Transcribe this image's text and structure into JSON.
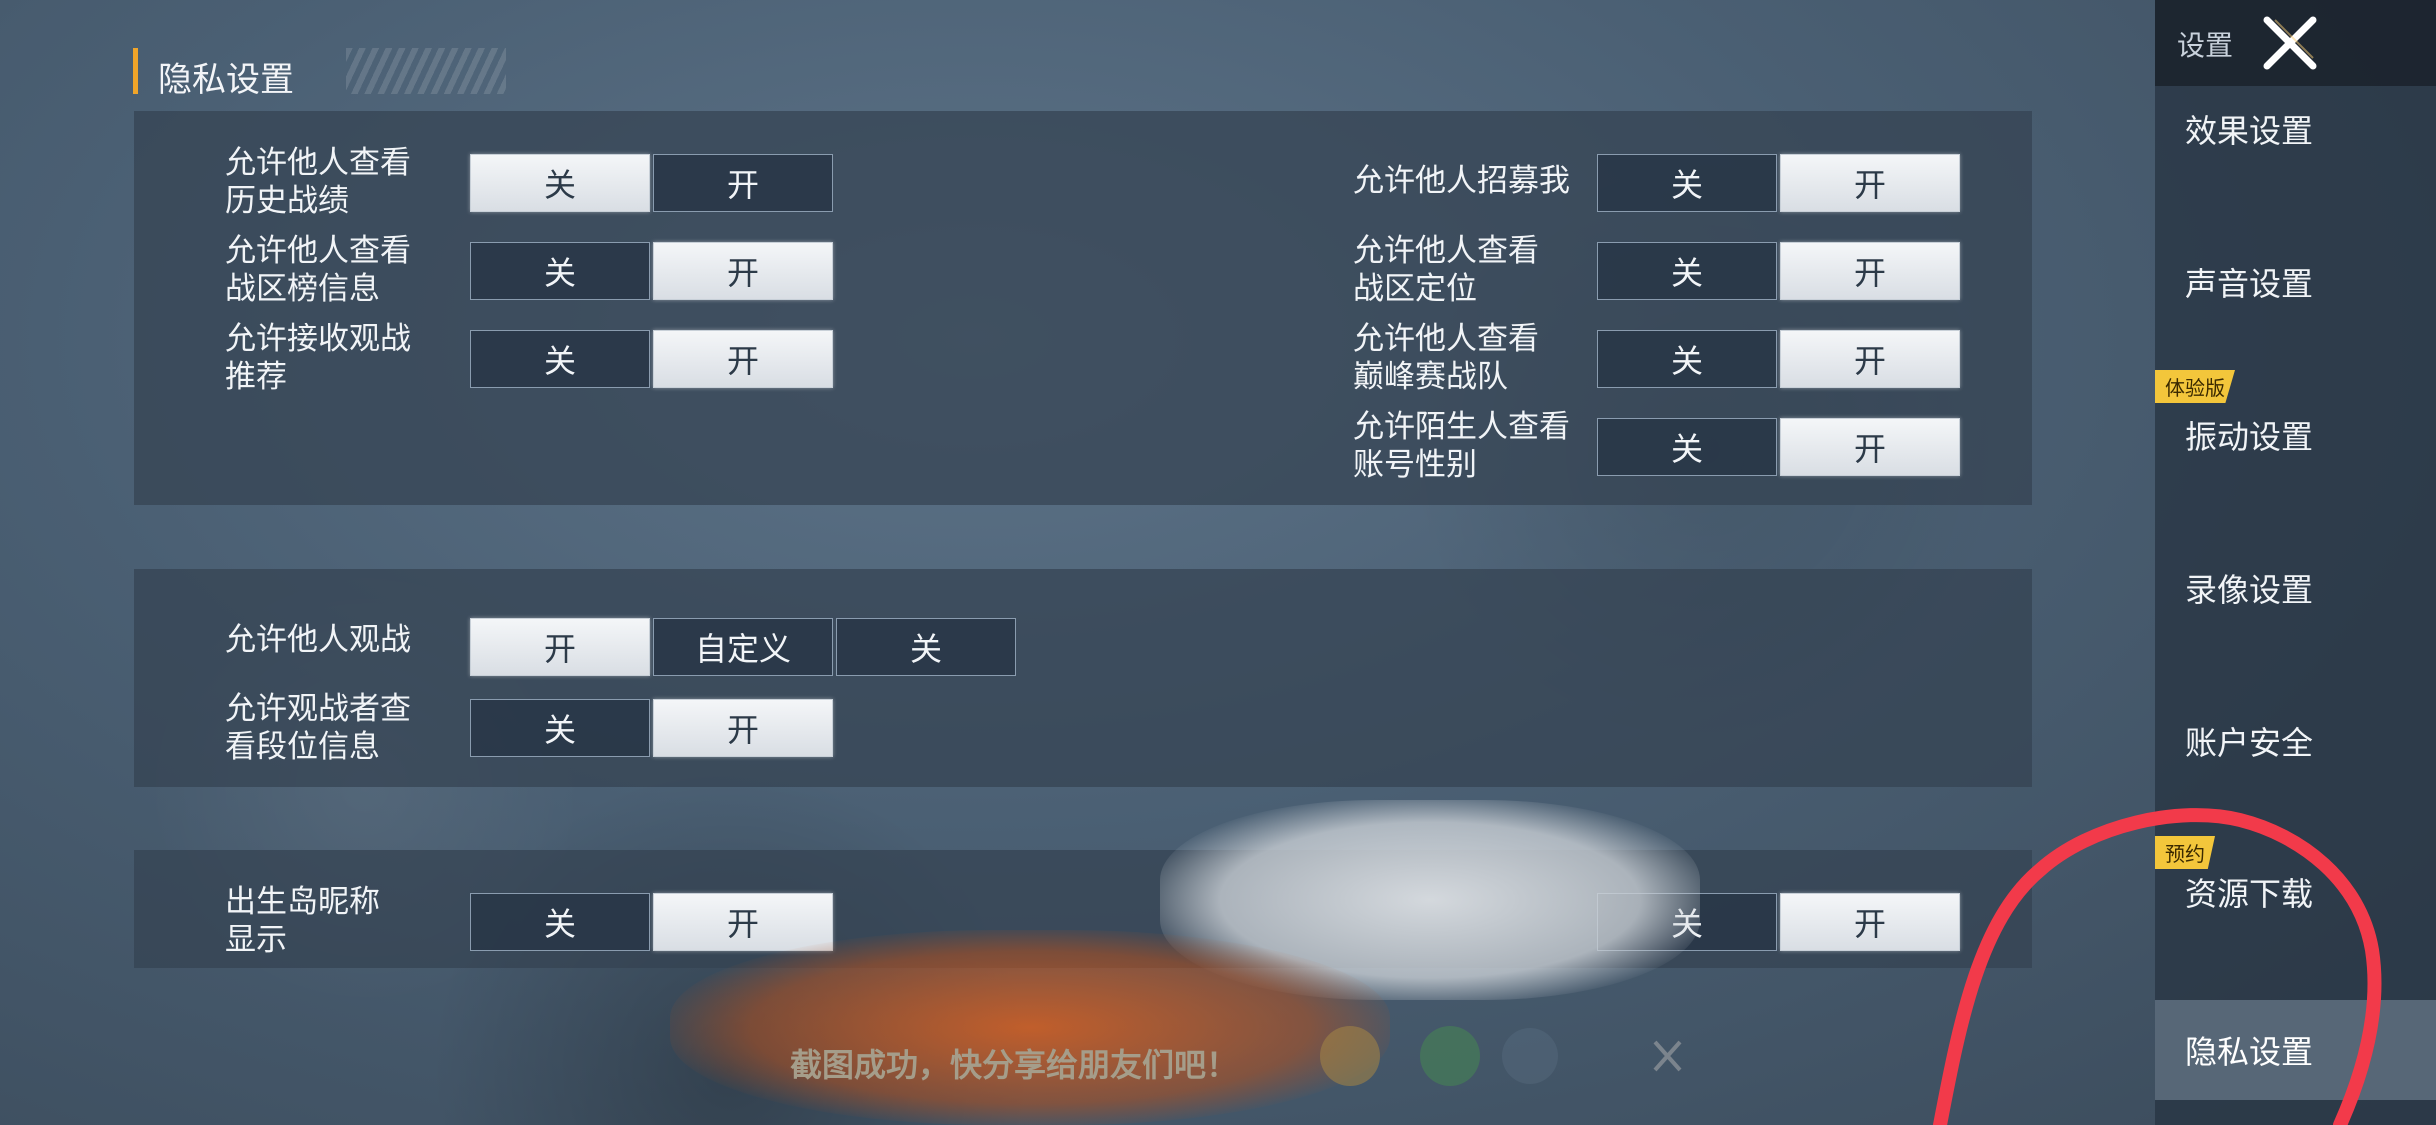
{
  "section": {
    "title": "隐私设置"
  },
  "settings_group_1": [
    {
      "label": "允许他人查看\n历史战绩",
      "options": [
        "关",
        "开"
      ],
      "selected": "关"
    },
    {
      "label": "允许他人查看\n战区榜信息",
      "options": [
        "关",
        "开"
      ],
      "selected": "开"
    },
    {
      "label": "允许接收观战\n推荐",
      "options": [
        "关",
        "开"
      ],
      "selected": "开"
    },
    {
      "label": "允许他人招募我",
      "options": [
        "关",
        "开"
      ],
      "selected": "开"
    },
    {
      "label": "允许他人查看\n战区定位",
      "options": [
        "关",
        "开"
      ],
      "selected": "开"
    },
    {
      "label": "允许他人查看\n巅峰赛战队",
      "options": [
        "关",
        "开"
      ],
      "selected": "开"
    },
    {
      "label": "允许陌生人查看\n账号性别",
      "options": [
        "关",
        "开"
      ],
      "selected": "开"
    }
  ],
  "settings_group_2": [
    {
      "label": "允许他人观战",
      "options": [
        "开",
        "自定义",
        "关"
      ],
      "selected": "开"
    },
    {
      "label": "允许观战者查\n看段位信息",
      "options": [
        "关",
        "开"
      ],
      "selected": "开"
    }
  ],
  "settings_group_3": [
    {
      "label": "出生岛昵称\n显示",
      "options": [
        "关",
        "开"
      ],
      "selected": "开"
    },
    {
      "label": "",
      "options": [
        "关",
        "开"
      ],
      "selected": "开"
    }
  ],
  "sidebar": {
    "title": "设置",
    "close_icon": "close-x-icon",
    "items": [
      {
        "label": "效果设置"
      },
      {
        "label": "声音设置"
      },
      {
        "label": "振动设置",
        "badge": "体验版"
      },
      {
        "label": "录像设置"
      },
      {
        "label": "账户安全"
      },
      {
        "label": "资源下载",
        "badge": "预约"
      },
      {
        "label": "隐私设置",
        "active": true
      }
    ]
  },
  "toast": {
    "text": "截图成功，快分享给朋友们吧！"
  },
  "colors": {
    "accent": "#f0a52a",
    "annotation_red": "#f23a4a",
    "badge": "#f3c63b"
  }
}
